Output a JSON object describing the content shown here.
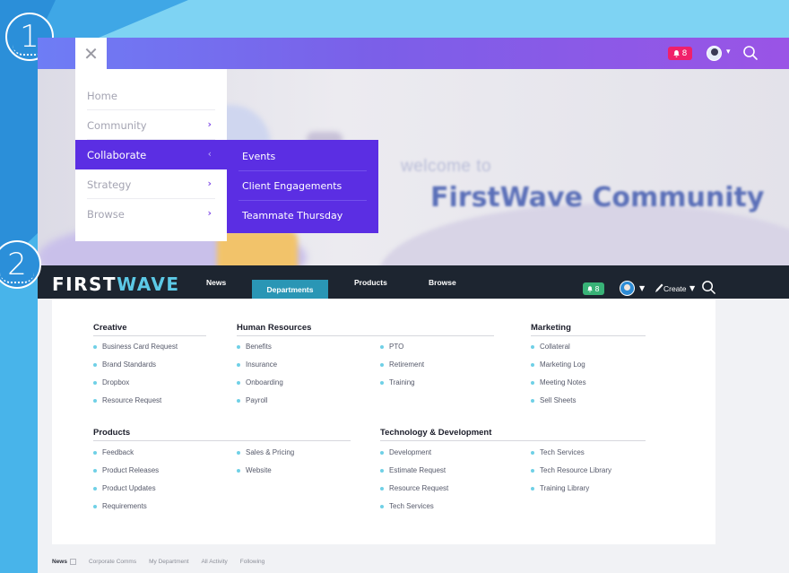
{
  "colors": {
    "page_bg": "#7ed3f3",
    "menu_accent": "#5b2ee3",
    "navbar_dark": "#1d2530",
    "nav_active": "#2a96b5",
    "logo_accent": "#5cc9e6",
    "bullet": "#6fd0e6",
    "notif_pink": "#f0206a",
    "notif_green": "#38b277"
  },
  "steps": [
    "1",
    "2"
  ],
  "shot1": {
    "notification_count": "8",
    "hero": {
      "welcome": "welcome to",
      "title": "FirstWave Community"
    },
    "menu": [
      {
        "label": "Home",
        "chevron": ""
      },
      {
        "label": "Community",
        "chevron": "›"
      },
      {
        "label": "Collaborate",
        "chevron": "‹"
      },
      {
        "label": "Strategy",
        "chevron": "›"
      },
      {
        "label": "Browse",
        "chevron": "›"
      }
    ],
    "submenu": [
      "Events",
      "Client Engagements",
      "Teammate Thursday"
    ]
  },
  "shot2": {
    "logo": {
      "part1": "FIRST",
      "part2": "WAVE"
    },
    "nav": [
      "News",
      "Departments",
      "Products",
      "Browse"
    ],
    "notification_count": "8",
    "create_label": "Create",
    "sections": {
      "creative": {
        "title": "Creative",
        "links": [
          "Business Card Request",
          "Brand Standards",
          "Dropbox",
          "Resource Request"
        ]
      },
      "hr": {
        "title": "Human Resources",
        "links_col1": [
          "Benefits",
          "Insurance",
          "Onboarding",
          "Payroll"
        ],
        "links_col2": [
          "PTO",
          "Retirement",
          "Training"
        ]
      },
      "marketing": {
        "title": "Marketing",
        "links": [
          "Collateral",
          "Marketing Log",
          "Meeting Notes",
          "Sell Sheets"
        ]
      },
      "products": {
        "title": "Products",
        "links_col1": [
          "Feedback",
          "Product Releases",
          "Product Updates",
          "Requirements"
        ],
        "links_col2": [
          "Sales & Pricing",
          "Website"
        ]
      },
      "tech": {
        "title": "Technology & Development",
        "links_col1": [
          "Development",
          "Estimate Request",
          "Resource Request",
          "Tech Services"
        ],
        "links_col2": [
          "Tech Services",
          "Tech Resource Library",
          "Training Library"
        ]
      }
    },
    "bottom_tabs": [
      "News",
      "Corporate Comms",
      "My Department",
      "All Activity",
      "Following"
    ]
  }
}
